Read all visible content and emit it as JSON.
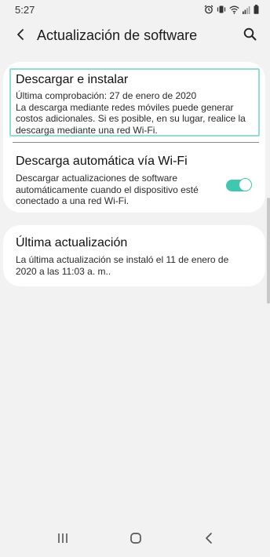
{
  "status_bar": {
    "time": "5:27",
    "icons": [
      "alarm-icon",
      "vibrate-icon",
      "wifi-icon",
      "signal-icon",
      "battery-icon"
    ]
  },
  "header": {
    "title": "Actualización de software",
    "back_icon": "chevron-left-icon",
    "search_icon": "search-icon"
  },
  "items": {
    "download": {
      "title": "Descargar e instalar",
      "description": "Última comprobación: 27 de enero de 2020\nLa descarga mediante redes móviles puede generar costos adicionales. Si es posible, en su lugar, realice la descarga mediante una red Wi-Fi."
    },
    "auto_download": {
      "title": "Descarga automática vía Wi-Fi",
      "description": "Descargar actualizaciones de software automáticamente cuando el dispositivo esté conectado a una red Wi-Fi.",
      "enabled": true
    },
    "last_update": {
      "title": "Última actualización",
      "description": "La última actualización se instaló el 11 de enero de 2020 a las 11:03 a. m.."
    }
  },
  "nav_bar": {
    "icons": [
      "recent-apps-icon",
      "home-icon",
      "back-icon"
    ]
  },
  "colors": {
    "accent": "#3fc8b0",
    "focus_border": "#8fded2",
    "background": "#f2f2f2",
    "card": "#ffffff"
  }
}
